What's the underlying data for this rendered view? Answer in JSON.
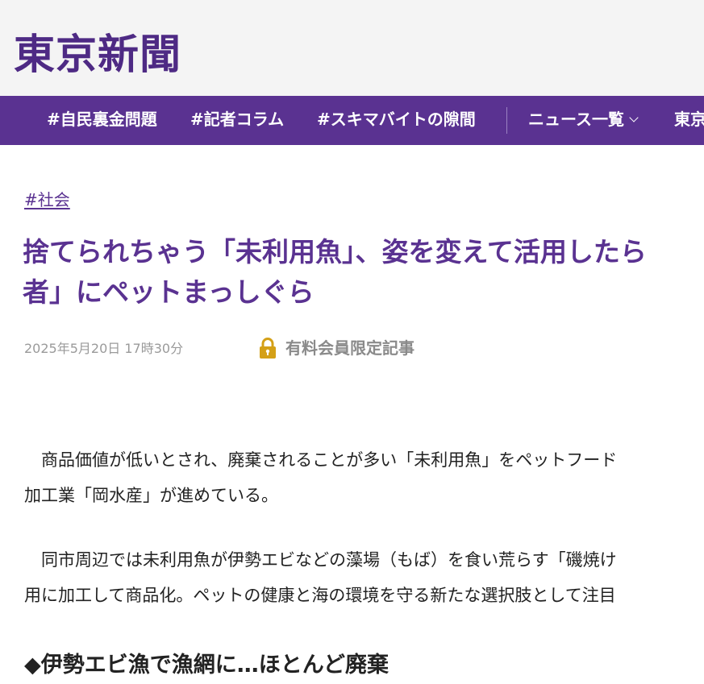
{
  "brand": {
    "logo": "東京新聞",
    "accent_color": "#5a3291",
    "masthead_bg": "#f4f4f4"
  },
  "nav": {
    "items": [
      {
        "label": "#自民裏金問題"
      },
      {
        "label": "#記者コラム"
      },
      {
        "label": "#スキマバイトの隙間"
      },
      {
        "label": "ニュース一覧",
        "has_dropdown": true,
        "icon": "chevron-down-icon"
      },
      {
        "label": "東京"
      }
    ]
  },
  "article": {
    "tag": "#社会",
    "headline_lines": [
      "捨てられちゃう「未利用魚」、姿を変えて活用したら",
      "者」にペットまっしぐら"
    ],
    "date": "2025年5月20日 17時30分",
    "member_icon": "lock-icon",
    "member_label": "有料会員限定記事",
    "paragraphs": [
      [
        "　商品価値が低いとされ、廃棄されることが多い「未利用魚」をペットフード",
        "加工業「岡水産」が進めている。"
      ],
      [
        "　同市周辺では未利用魚が伊勢エビなどの藻場（もば）を食い荒らす「磯焼け",
        "用に加工して商品化。ペットの健康と海の環境を守る新たな選択肢として注目"
      ]
    ],
    "subheading": "◆伊勢エビ漁で漁網に…ほとんど廃棄"
  }
}
